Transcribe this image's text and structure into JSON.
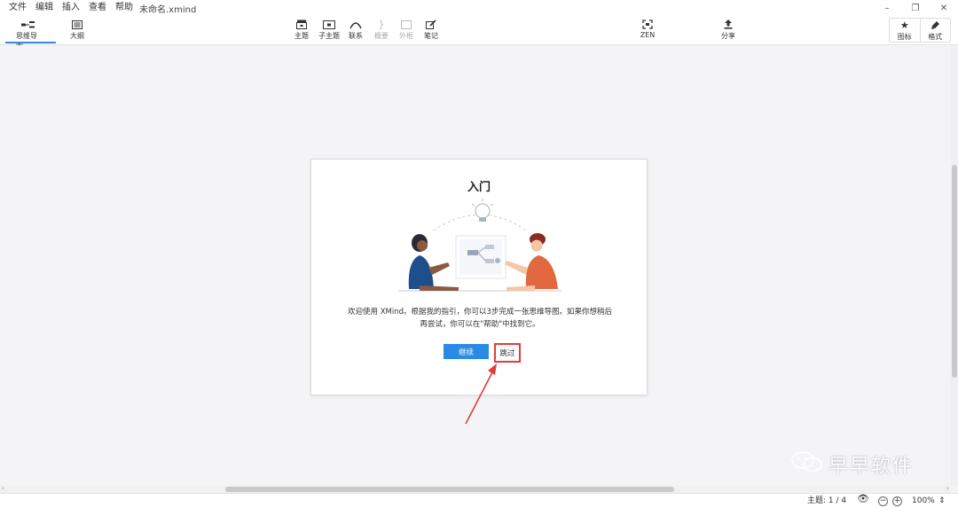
{
  "menu": {
    "items": [
      "文件",
      "编辑",
      "插入",
      "查看",
      "帮助"
    ],
    "document_title": "未命名.xmind"
  },
  "window_controls": {
    "minimize": "–",
    "restore": "❐",
    "close": "✕"
  },
  "toolbar": {
    "view_tabs": [
      {
        "label": "思维导图",
        "icon": "mindmap-icon",
        "active": true
      },
      {
        "label": "大纲",
        "icon": "outline-icon",
        "active": false
      }
    ],
    "tools": [
      {
        "label": "主题",
        "icon": "topic-icon",
        "enabled": true
      },
      {
        "label": "子主题",
        "icon": "subtopic-icon",
        "enabled": true
      },
      {
        "label": "联系",
        "icon": "relationship-icon",
        "enabled": true
      },
      {
        "label": "概要",
        "icon": "summary-icon",
        "enabled": false
      },
      {
        "label": "外框",
        "icon": "boundary-icon",
        "enabled": false
      },
      {
        "label": "笔记",
        "icon": "note-icon",
        "enabled": true
      }
    ],
    "zen": {
      "label": "ZEN",
      "icon": "zen-icon"
    },
    "share": {
      "label": "分享",
      "icon": "share-icon"
    },
    "panels": [
      {
        "label": "图标",
        "icon": "star-icon"
      },
      {
        "label": "格式",
        "icon": "brush-icon"
      }
    ]
  },
  "dialog": {
    "title": "入门",
    "body_line1": "欢迎使用 XMind。根据我的指引，你可以3步完成一张思维导图。如果你想稍后",
    "body_line2": "再尝试，你可以在\"帮助\"中找到它。",
    "continue_label": "继续",
    "skip_label": "跳过"
  },
  "statusbar": {
    "topic_count": "主题: 1 / 4",
    "zoom": "100%"
  },
  "watermark": {
    "text": "早早软件"
  },
  "colors": {
    "accent": "#2a8be6",
    "annotation": "#e23b3b"
  }
}
